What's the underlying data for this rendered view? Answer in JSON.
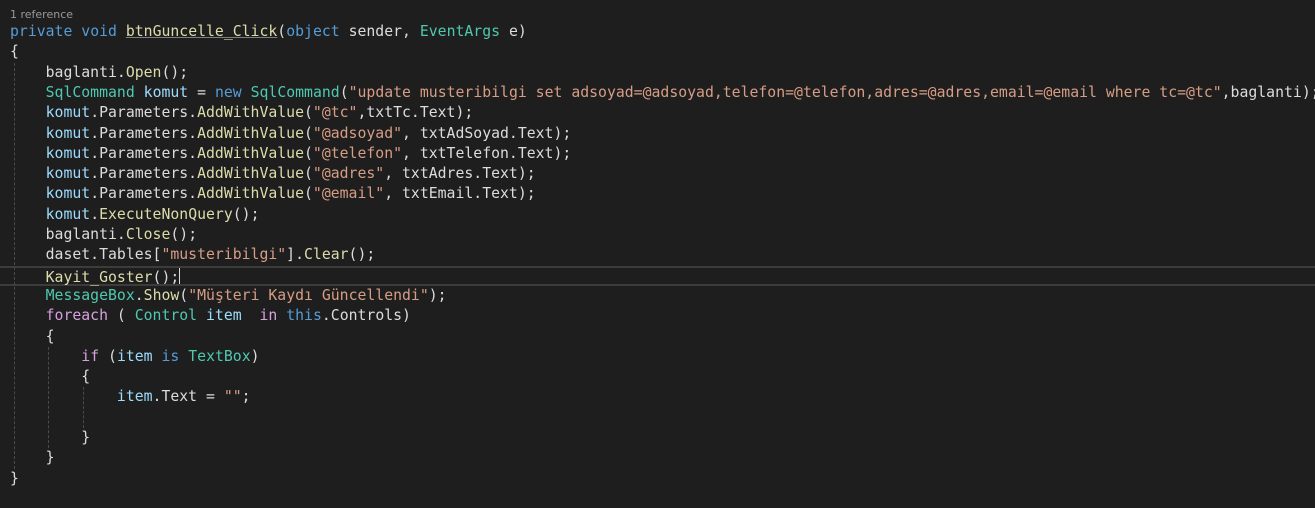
{
  "codelens": "1 reference",
  "colors": {
    "background": "#1e1e1e",
    "keyword": "#569cd6",
    "control_keyword": "#d8a0df",
    "type": "#4ec9b0",
    "method": "#dcdcaa",
    "string": "#d69d85",
    "local": "#9cdcfe",
    "plain": "#dcdcdc",
    "codelens": "#999999"
  },
  "lines": [
    {
      "indent": "",
      "tokens": [
        [
          "private",
          "kw"
        ],
        [
          " ",
          "pl"
        ],
        [
          "void",
          "kw"
        ],
        [
          " ",
          "pl"
        ],
        [
          "btnGuncelle_Click",
          "fn ul"
        ],
        [
          "(",
          "pl"
        ],
        [
          "object",
          "kw"
        ],
        [
          " sender, ",
          "pl"
        ],
        [
          "EventArgs",
          "ty"
        ],
        [
          " e)",
          "pl"
        ]
      ]
    },
    {
      "indent": "",
      "tokens": [
        [
          "{",
          "pl"
        ]
      ]
    },
    {
      "indent": "    ",
      "tokens": [
        [
          "baglanti.",
          "pl"
        ],
        [
          "Open",
          "fn"
        ],
        [
          "();",
          "pl"
        ]
      ]
    },
    {
      "indent": "    ",
      "tokens": [
        [
          "SqlCommand",
          "ty"
        ],
        [
          " ",
          "pl"
        ],
        [
          "komut",
          "var"
        ],
        [
          " = ",
          "pl"
        ],
        [
          "new",
          "kw"
        ],
        [
          " ",
          "pl"
        ],
        [
          "SqlCommand",
          "ty"
        ],
        [
          "(",
          "pl"
        ],
        [
          "\"update musteribilgi set adsoyad=@adsoyad,telefon=@telefon,adres=@adres,email=@email where tc=@tc\"",
          "str"
        ],
        [
          ",baglanti);",
          "pl"
        ]
      ]
    },
    {
      "indent": "    ",
      "tokens": [
        [
          "komut",
          "var"
        ],
        [
          ".Parameters.",
          "pl"
        ],
        [
          "AddWithValue",
          "fn"
        ],
        [
          "(",
          "pl"
        ],
        [
          "\"@tc\"",
          "str"
        ],
        [
          ",txtTc.Text);",
          "pl"
        ]
      ]
    },
    {
      "indent": "    ",
      "tokens": [
        [
          "komut",
          "var"
        ],
        [
          ".Parameters.",
          "pl"
        ],
        [
          "AddWithValue",
          "fn"
        ],
        [
          "(",
          "pl"
        ],
        [
          "\"@adsoyad\"",
          "str"
        ],
        [
          ", txtAdSoyad.Text);",
          "pl"
        ]
      ]
    },
    {
      "indent": "    ",
      "tokens": [
        [
          "komut",
          "var"
        ],
        [
          ".Parameters.",
          "pl"
        ],
        [
          "AddWithValue",
          "fn"
        ],
        [
          "(",
          "pl"
        ],
        [
          "\"@telefon\"",
          "str"
        ],
        [
          ", txtTelefon.Text);",
          "pl"
        ]
      ]
    },
    {
      "indent": "    ",
      "tokens": [
        [
          "komut",
          "var"
        ],
        [
          ".Parameters.",
          "pl"
        ],
        [
          "AddWithValue",
          "fn"
        ],
        [
          "(",
          "pl"
        ],
        [
          "\"@adres\"",
          "str"
        ],
        [
          ", txtAdres.Text);",
          "pl"
        ]
      ]
    },
    {
      "indent": "    ",
      "tokens": [
        [
          "komut",
          "var"
        ],
        [
          ".Parameters.",
          "pl"
        ],
        [
          "AddWithValue",
          "fn"
        ],
        [
          "(",
          "pl"
        ],
        [
          "\"@email\"",
          "str"
        ],
        [
          ", txtEmail.Text);",
          "pl"
        ]
      ]
    },
    {
      "indent": "    ",
      "tokens": [
        [
          "komut",
          "var"
        ],
        [
          ".",
          "pl"
        ],
        [
          "ExecuteNonQuery",
          "fn"
        ],
        [
          "();",
          "pl"
        ]
      ]
    },
    {
      "indent": "    ",
      "tokens": [
        [
          "baglanti.",
          "pl"
        ],
        [
          "Close",
          "fn"
        ],
        [
          "();",
          "pl"
        ]
      ]
    },
    {
      "indent": "    ",
      "tokens": [
        [
          "daset.Tables[",
          "pl"
        ],
        [
          "\"musteribilgi\"",
          "str"
        ],
        [
          "].",
          "pl"
        ],
        [
          "Clear",
          "fn"
        ],
        [
          "();",
          "pl"
        ]
      ]
    },
    {
      "indent": "    ",
      "current": true,
      "tokens": [
        [
          "Kayit_Goster",
          "fn"
        ],
        [
          "();",
          "pl"
        ]
      ]
    },
    {
      "indent": "    ",
      "tokens": [
        [
          "MessageBox",
          "ty"
        ],
        [
          ".",
          "pl"
        ],
        [
          "Show",
          "fn"
        ],
        [
          "(",
          "pl"
        ],
        [
          "\"Müşteri Kaydı Güncellendi\"",
          "str"
        ],
        [
          ");",
          "pl"
        ]
      ]
    },
    {
      "indent": "    ",
      "tokens": [
        [
          "foreach",
          "ctl"
        ],
        [
          " ( ",
          "pl"
        ],
        [
          "Control",
          "ty"
        ],
        [
          " ",
          "pl"
        ],
        [
          "item",
          "var"
        ],
        [
          "  ",
          "pl"
        ],
        [
          "in",
          "ctl"
        ],
        [
          " ",
          "pl"
        ],
        [
          "this",
          "kw"
        ],
        [
          ".Controls)",
          "pl"
        ]
      ]
    },
    {
      "indent": "    ",
      "tokens": [
        [
          "{",
          "pl"
        ]
      ]
    },
    {
      "indent": "        ",
      "tokens": [
        [
          "if",
          "ctl"
        ],
        [
          " (",
          "pl"
        ],
        [
          "item",
          "var"
        ],
        [
          " ",
          "pl"
        ],
        [
          "is",
          "kw"
        ],
        [
          " ",
          "pl"
        ],
        [
          "TextBox",
          "ty"
        ],
        [
          ")",
          "pl"
        ]
      ]
    },
    {
      "indent": "        ",
      "tokens": [
        [
          "{",
          "pl"
        ]
      ]
    },
    {
      "indent": "            ",
      "tokens": [
        [
          "item",
          "var"
        ],
        [
          ".Text = ",
          "pl"
        ],
        [
          "\"\"",
          "str"
        ],
        [
          ";",
          "pl"
        ]
      ]
    },
    {
      "indent": "",
      "tokens": []
    },
    {
      "indent": "        ",
      "tokens": [
        [
          "}",
          "pl"
        ]
      ]
    },
    {
      "indent": "    ",
      "tokens": [
        [
          "}",
          "pl"
        ]
      ]
    },
    {
      "indent": "",
      "tokens": [
        [
          "}",
          "pl"
        ]
      ]
    }
  ]
}
